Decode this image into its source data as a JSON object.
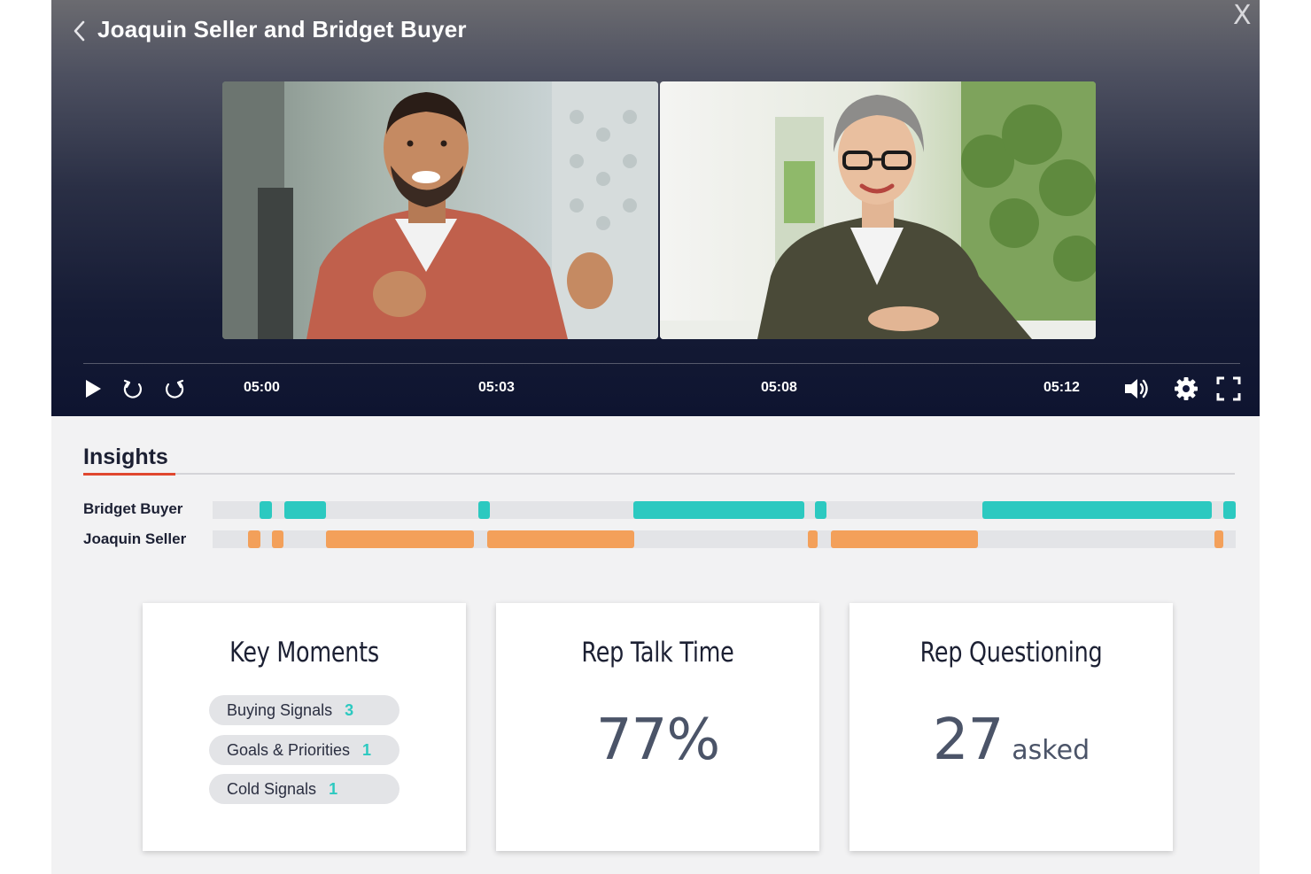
{
  "header": {
    "title": "Joaquin Seller and Bridget Buyer",
    "close_label": "X"
  },
  "player": {
    "timestamps": [
      "05:00",
      "05:03",
      "05:08",
      "05:12"
    ],
    "videos": [
      {
        "participant": "Joaquin Seller"
      },
      {
        "participant": "Bridget Buyer"
      }
    ],
    "controls": [
      "play-icon",
      "rewind-icon",
      "forward-icon",
      "volume-icon",
      "settings-gear-icon",
      "fullscreen-icon"
    ]
  },
  "insights": {
    "title": "Insights",
    "accent": "#e0472f",
    "buyer_color": "#2cc9c0",
    "seller_color": "#f3a05a",
    "speakers": [
      {
        "name": "Bridget Buyer",
        "segments": [
          [
            0.046,
            0.058
          ],
          [
            0.07,
            0.111
          ],
          [
            0.26,
            0.271
          ],
          [
            0.411,
            0.578
          ],
          [
            0.589,
            0.6
          ],
          [
            0.752,
            0.977
          ],
          [
            0.988,
            1.0
          ]
        ]
      },
      {
        "name": "Joaquin Seller",
        "segments": [
          [
            0.035,
            0.047
          ],
          [
            0.058,
            0.069
          ],
          [
            0.111,
            0.255
          ],
          [
            0.268,
            0.412
          ],
          [
            0.582,
            0.591
          ],
          [
            0.604,
            0.748
          ],
          [
            0.979,
            0.988
          ]
        ]
      }
    ]
  },
  "cards": {
    "key_moments": {
      "title": "Key Moments",
      "items": [
        {
          "label": "Buying Signals",
          "count": "3"
        },
        {
          "label": "Goals & Priorities",
          "count": "1"
        },
        {
          "label": "Cold Signals",
          "count": "1"
        }
      ]
    },
    "talk_time": {
      "title": "Rep Talk Time",
      "value": "77%"
    },
    "questioning": {
      "title": "Rep Questioning",
      "value": "27",
      "unit": "asked"
    }
  }
}
